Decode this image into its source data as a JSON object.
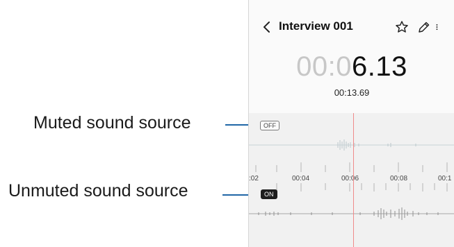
{
  "callouts": {
    "muted_label": "Muted sound source",
    "unmuted_label": "Unmuted sound source"
  },
  "recording": {
    "title": "Interview 001",
    "elapsed_dim": "00:0",
    "elapsed_lit": "6.13",
    "total_time": "00:13.69"
  },
  "tracks": {
    "muted_badge": "OFF",
    "unmuted_badge": "ON"
  },
  "timeline": {
    "ticks": [
      ":02",
      "00:04",
      "00:06",
      "00:08",
      "00:1"
    ]
  },
  "icons": {
    "back": "chevron-left-icon",
    "favorite": "star-outline-icon",
    "rename": "pencil-icon",
    "more": "more-vertical-icon"
  },
  "colors": {
    "leader": "#1f66a6",
    "playhead": "#f08a8a",
    "muted_wave": "#bcc8cc",
    "unmuted_wave": "#8f8f8f"
  }
}
